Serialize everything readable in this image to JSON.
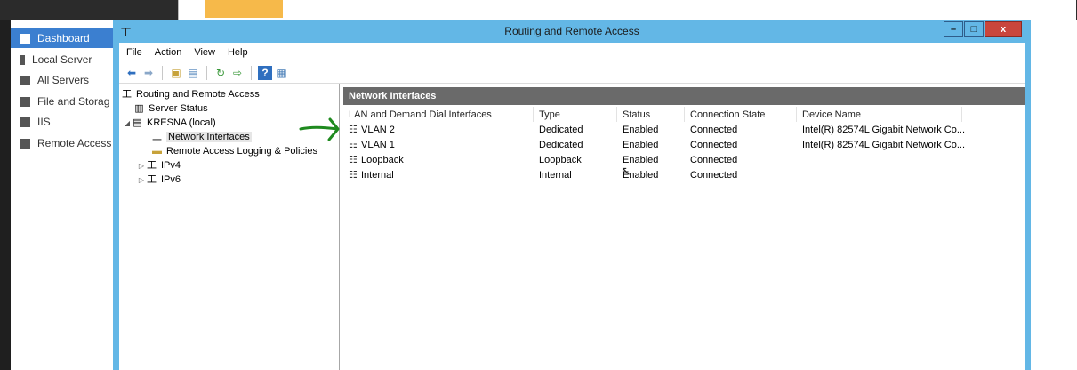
{
  "server_manager": {
    "nav": [
      {
        "label": "Dashboard",
        "icon": "dashboard-icon",
        "active": true
      },
      {
        "label": "Local Server",
        "icon": "server-icon"
      },
      {
        "label": "All Servers",
        "icon": "servers-icon"
      },
      {
        "label": "File and Storag",
        "icon": "storage-icon"
      },
      {
        "label": "IIS",
        "icon": "iis-icon"
      },
      {
        "label": "Remote Access",
        "icon": "remote-access-icon"
      }
    ]
  },
  "window": {
    "title": "Routing and Remote Access",
    "controls": {
      "minimize": "–",
      "maximize": "□",
      "close": "x"
    }
  },
  "menu": [
    "File",
    "Action",
    "View",
    "Help"
  ],
  "tree": {
    "root": "Routing and Remote Access",
    "items": [
      {
        "label": "Server Status"
      },
      {
        "label": "KRESNA (local)"
      },
      {
        "label": "Network Interfaces"
      },
      {
        "label": "Remote Access Logging & Policies"
      },
      {
        "label": "IPv4"
      },
      {
        "label": "IPv6"
      }
    ]
  },
  "pane": {
    "header": "Network Interfaces",
    "columns": [
      "LAN and Demand Dial Interfaces",
      "Type",
      "Status",
      "Connection State",
      "Device Name"
    ],
    "rows": [
      [
        "VLAN 2",
        "Dedicated",
        "Enabled",
        "Connected",
        "Intel(R) 82574L Gigabit Network Co..."
      ],
      [
        "VLAN 1",
        "Dedicated",
        "Enabled",
        "Connected",
        "Intel(R) 82574L Gigabit Network Co..."
      ],
      [
        "Loopback",
        "Loopback",
        "Enabled",
        "Connected",
        ""
      ],
      [
        "Internal",
        "Internal",
        "Enabled",
        "Connected",
        ""
      ]
    ]
  },
  "colors": {
    "window_frame": "#63b7e6",
    "close_button": "#c9463d",
    "nav_active": "#3b7fd0",
    "pane_header": "#6a6a6a",
    "annotation_arrow": "#1f8a1f"
  }
}
